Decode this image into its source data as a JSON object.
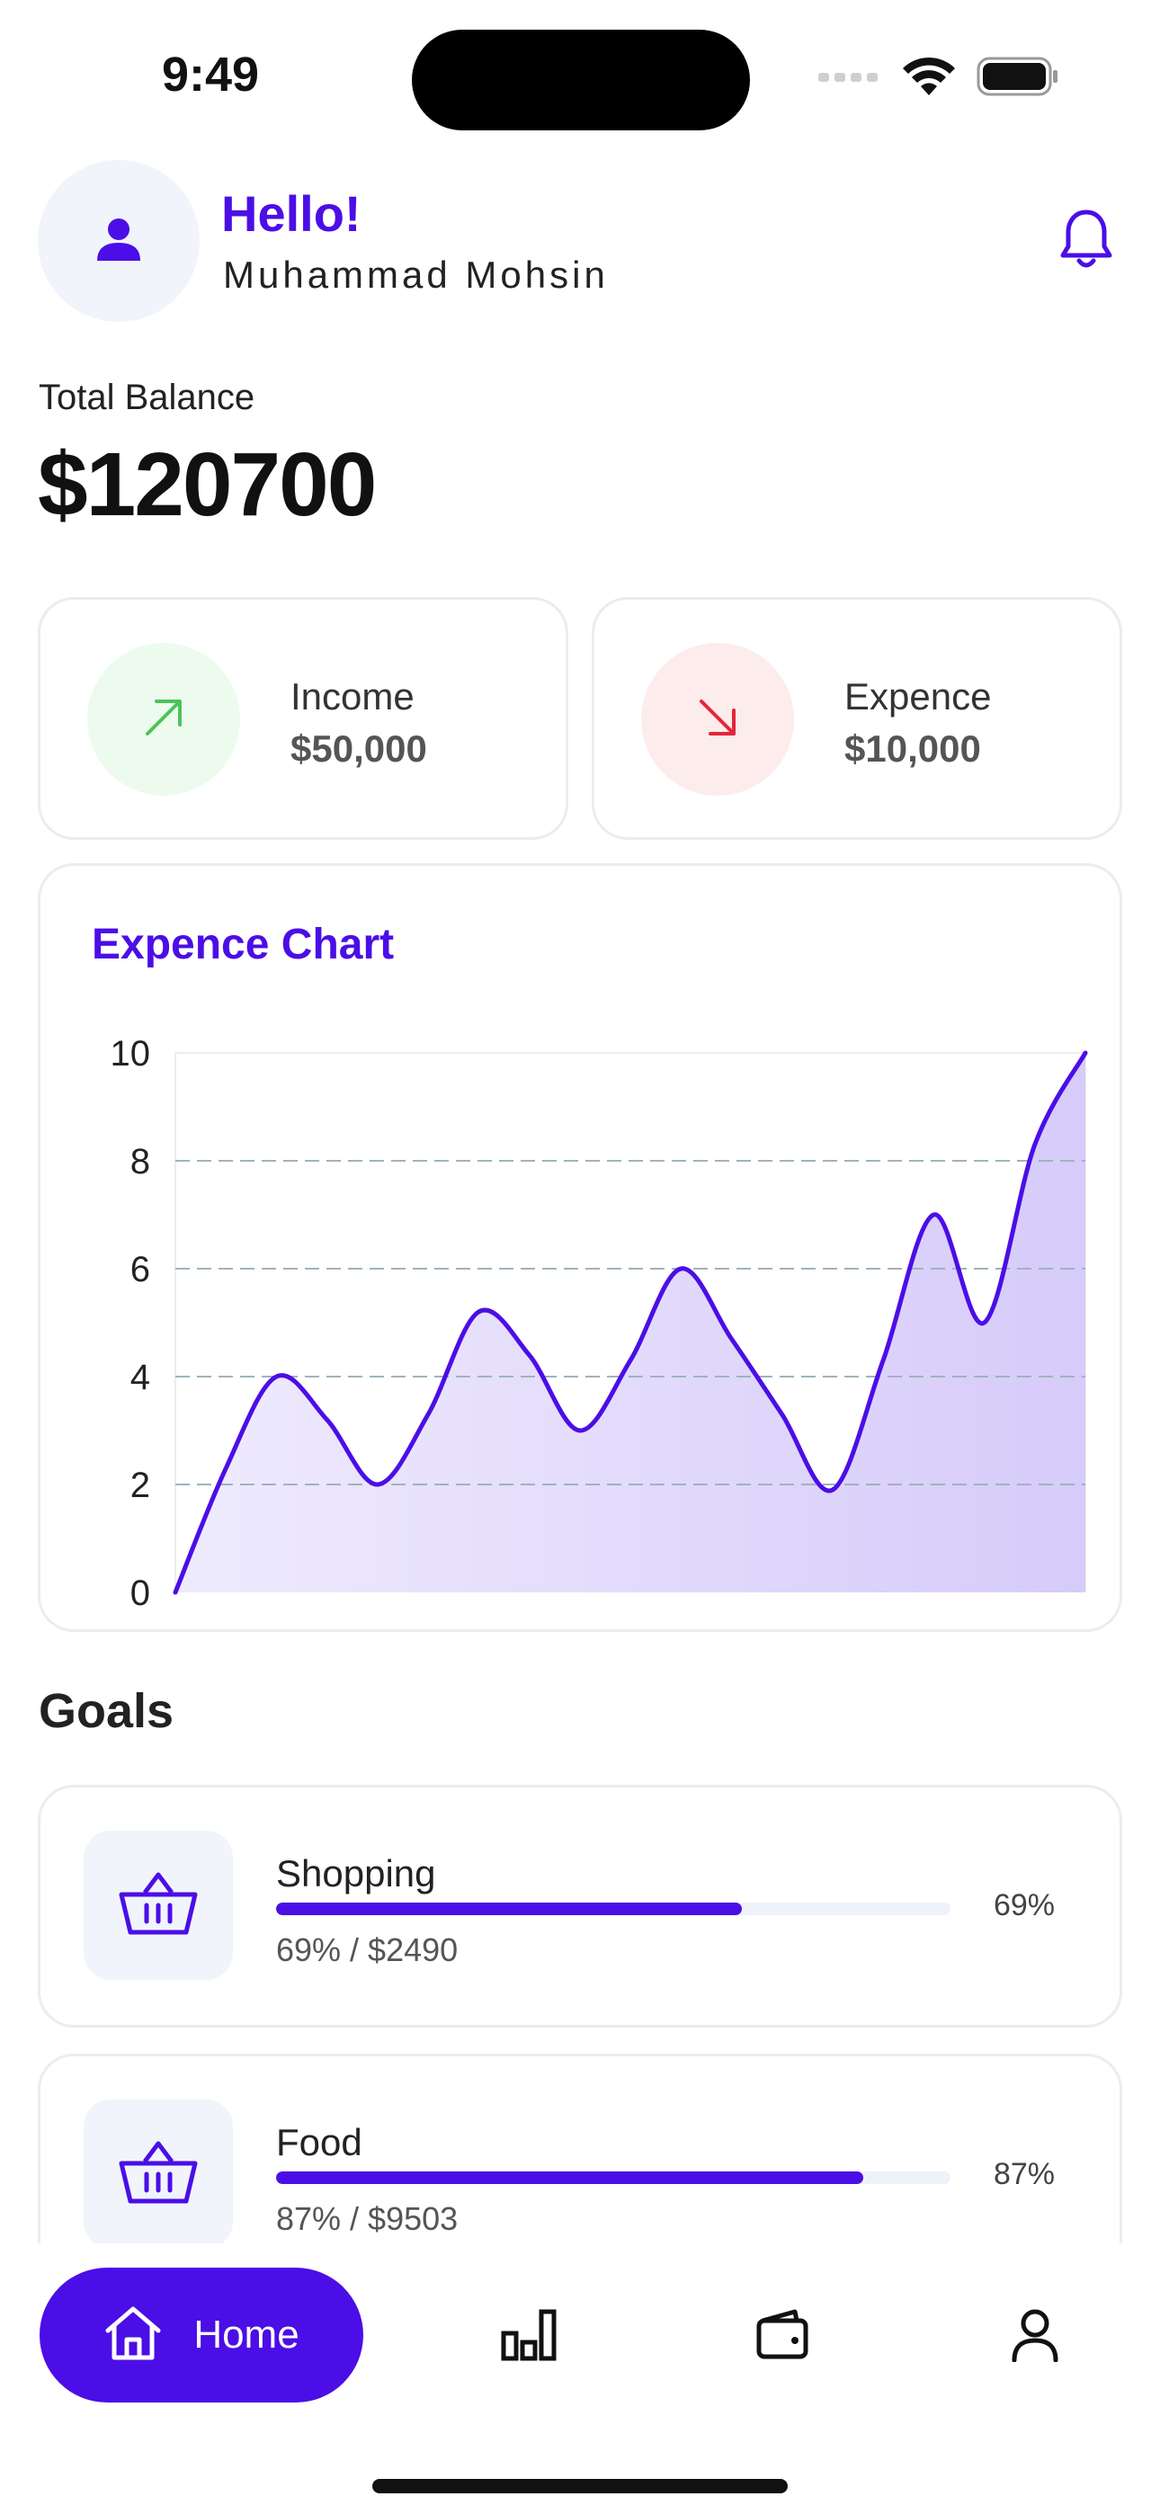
{
  "status_bar": {
    "time": "9:49"
  },
  "header": {
    "greeting": "Hello!",
    "user_name": "Muhammad Mohsin"
  },
  "balance": {
    "label": "Total Balance",
    "value": "$120700"
  },
  "stats": {
    "income": {
      "label": "Income",
      "value": "$50,000",
      "color": "#4cc35a",
      "bg": "#edfbef"
    },
    "expense": {
      "label": "Expence",
      "value": "$10,000",
      "color": "#e5253a",
      "bg": "#fdecec"
    }
  },
  "chart_data": {
    "type": "area",
    "title": "Expence Chart",
    "x": [
      0,
      1,
      2,
      3,
      4,
      5,
      6,
      7,
      8,
      9,
      10,
      11,
      12,
      13,
      14,
      15,
      16,
      17,
      18
    ],
    "values": [
      0,
      2.3,
      4.0,
      3.2,
      2.0,
      3.3,
      5.2,
      4.4,
      3.0,
      4.3,
      6.0,
      4.7,
      3.3,
      1.9,
      4.3,
      7.0,
      5.0,
      8.3,
      10.0
    ],
    "yticks": [
      "0",
      "2",
      "4",
      "6",
      "8",
      "10"
    ],
    "ylim": [
      0,
      10
    ],
    "grid": "dashed horizontal",
    "line_color": "#4b0ee6",
    "fill_color": "#d6cbfa"
  },
  "goals": {
    "title": "Goals",
    "items": [
      {
        "name": "Shopping",
        "detail": "69% / $2490",
        "percent_label": "69%",
        "progress": 0.69
      },
      {
        "name": "Food",
        "detail": "87% / $9503",
        "percent_label": "87%",
        "progress": 0.87
      }
    ]
  },
  "nav": {
    "home_label": "Home",
    "accent": "#4b0ee6"
  }
}
